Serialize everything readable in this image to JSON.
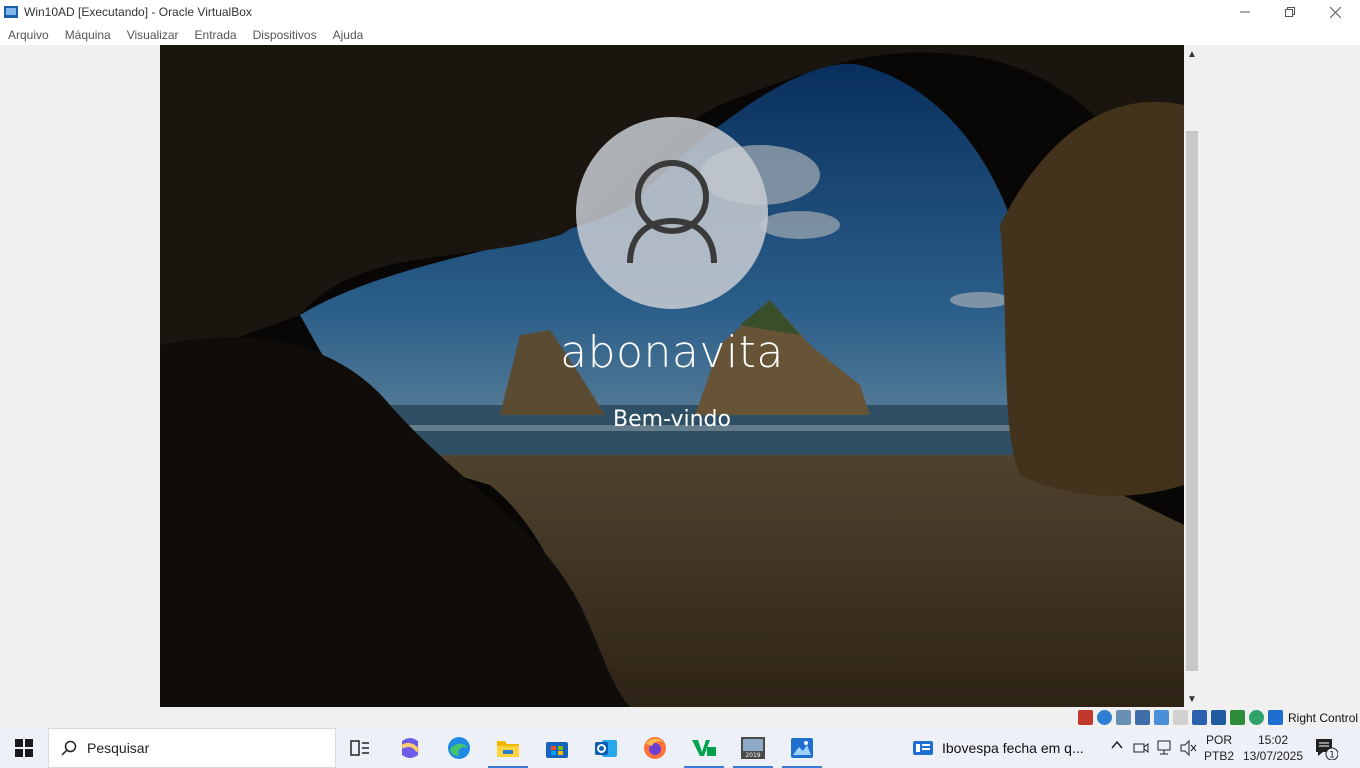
{
  "window": {
    "title": "Win10AD [Executando] - Oracle VirtualBox",
    "icon": "virtualbox-icon"
  },
  "menu": {
    "items": [
      "Arquivo",
      "Máquina",
      "Visualizar",
      "Entrada",
      "Dispositivos",
      "Ajuda"
    ]
  },
  "login": {
    "username": "abonavita",
    "status": "Bem-vindo",
    "avatar_icon": "user-icon"
  },
  "vbox_status": {
    "host_key": "Right Control",
    "icons": [
      "hard-disk-icon",
      "optical-drive-icon",
      "audio-icon",
      "network-icon",
      "usb-icon",
      "shared-folders-icon",
      "display-icon",
      "recording-icon",
      "cpu-icon",
      "mouse-integration-icon",
      "keyboard-icon"
    ]
  },
  "taskbar": {
    "search_placeholder": "Pesquisar",
    "apps": [
      "task-view",
      "copilot",
      "edge",
      "file-explorer",
      "microsoft-store",
      "outlook",
      "firefox",
      "veeam",
      "sql-server-2019",
      "photos"
    ],
    "news": "Ibovespa fecha em q...",
    "language_line1": "POR",
    "language_line2": "PTB2",
    "time": "15:02",
    "date": "13/07/2025",
    "notification_count": "1"
  }
}
